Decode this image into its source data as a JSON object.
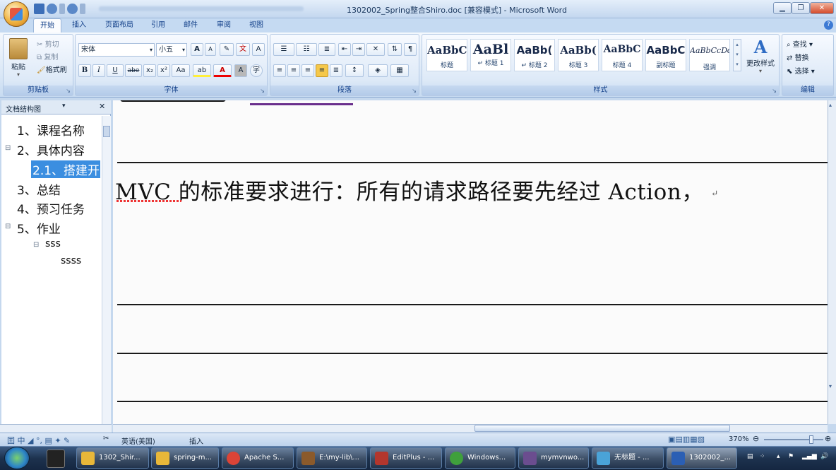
{
  "window": {
    "title": "1302002_Spring整合Shiro.doc [兼容模式] - Microsoft Word",
    "minimize_icon": "minimize-icon",
    "maximize_icon": "maximize-icon",
    "close_icon": "close-icon"
  },
  "ribbon_tabs": [
    "开始",
    "插入",
    "页面布局",
    "引用",
    "邮件",
    "审阅",
    "视图"
  ],
  "clipboard": {
    "paste": "粘贴",
    "cut": "剪切",
    "copy": "复制",
    "format_painter": "格式刷",
    "group_label": "剪贴板"
  },
  "font": {
    "family": "宋体",
    "size": "小五",
    "group_label": "字体",
    "buttons": [
      "B",
      "I",
      "U",
      "abe",
      "x₂",
      "x²",
      "Aa"
    ],
    "grow": "A",
    "shrink": "A"
  },
  "paragraph": {
    "group_label": "段落"
  },
  "styles": {
    "group_label": "样式",
    "items": [
      {
        "sample": "AaBbC",
        "name": "标题"
      },
      {
        "sample": "AaBl",
        "name": "↵ 标题 1"
      },
      {
        "sample": "AaBb(",
        "name": "↵ 标题 2"
      },
      {
        "sample": "AaBb(",
        "name": "标题 3"
      },
      {
        "sample": "AaBbC",
        "name": "标题 4"
      },
      {
        "sample": "AaBbC",
        "name": "副标题"
      },
      {
        "sample": "AaBbCcDd",
        "name": "强调"
      }
    ],
    "change_styles": "更改样式"
  },
  "editing": {
    "find": "查找",
    "replace": "替换",
    "select": "选择",
    "group_label": "编辑"
  },
  "doc_map": {
    "title": "文档结构图",
    "items": [
      "1、课程名称",
      "2、具体内容",
      "2.1、搭建开",
      "3、总结",
      "4、预习任务",
      "5、作业",
      "sss",
      "ssss"
    ]
  },
  "document": {
    "visible_line": "MVC 的标准要求进行：所有的请求路径要先经过 Action，",
    "paragraph_mark": "↵"
  },
  "status_bar": {
    "language": "英语(美国)",
    "mode": "插入",
    "zoom": "370%"
  },
  "taskbar": {
    "items": [
      {
        "label": "1302_Shir...",
        "icon": "folder-icon",
        "color": "#e8b739"
      },
      {
        "label": "spring-m...",
        "icon": "folder-icon",
        "color": "#e8b739"
      },
      {
        "label": "Apache S...",
        "icon": "chrome-icon",
        "color": "#db4437"
      },
      {
        "label": "E:\\my-lib\\...",
        "icon": "editor-icon",
        "color": "#8b5a2b"
      },
      {
        "label": "EditPlus - ...",
        "icon": "editplus-icon",
        "color": "#b3362d"
      },
      {
        "label": "Windows...",
        "icon": "windows-icon",
        "color": "#3fa03c"
      },
      {
        "label": "mymvnwo...",
        "icon": "java-icon",
        "color": "#6b4d8f"
      },
      {
        "label": "无标题 - ...",
        "icon": "paint-icon",
        "color": "#4aa3d8"
      },
      {
        "label": "1302002_...",
        "icon": "word-icon",
        "color": "#2b5fb4"
      }
    ]
  }
}
